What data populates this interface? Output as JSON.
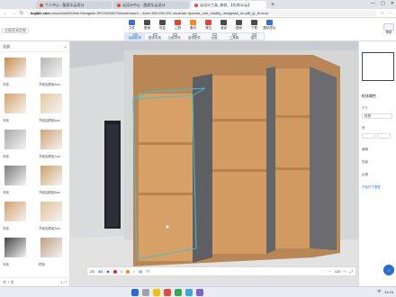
{
  "browser": {
    "tabs": [
      {
        "title": "个人中心 - 酷家乐云设计",
        "active": false
      },
      {
        "title": "云设计中心 - 酷家乐云设计",
        "active": false
      },
      {
        "title": "云设计工具_装修_【在线3D云】",
        "active": true
      }
    ],
    "new_tab": "+",
    "url_host": "kujiale.com",
    "url_path": "/cloud/tool/h5/bim?designid=3FO3U50B70&redirecturl=...&nm=000.000.001.zhuzhan.diploma_cert_modify_designid&_id=y8t_gi_th=true"
  },
  "app": {
    "left_label": "全屋家具定制",
    "top_tools": [
      {
        "label": "文件",
        "color": "#3b6fd1"
      },
      {
        "label": "撤销",
        "color": "#4b4b4b"
      },
      {
        "label": "恢复",
        "color": "#4b4b4b"
      },
      {
        "label": "工具",
        "color": "#e0433a"
      },
      {
        "label": "素材",
        "color": "#f28a1e"
      },
      {
        "label": "清空",
        "color": "#e0433a"
      },
      {
        "label": "渲染",
        "color": "#4b4b4b"
      },
      {
        "label": "图纸",
        "color": "#4b4b4b"
      },
      {
        "label": "下载",
        "color": "#4b4b4b"
      },
      {
        "label": "图纸导出",
        "color": "#3b6fd1"
      }
    ],
    "sub_tools": [
      "绘制柜体",
      "整体布局",
      "功能零件",
      "装饰配件",
      "台面",
      "工具箱",
      "组件"
    ],
    "right_button": "帮助"
  },
  "library": {
    "header": "全部",
    "items": [
      {
        "label": "衣柜",
        "color": "#c98b4b"
      },
      {
        "label": "书柜抽屉组6cm",
        "color": "#b7b7b7"
      },
      {
        "label": "衣柜",
        "color": "#d8a46a"
      },
      {
        "label": "书柜抽屉组6cm",
        "color": "#e5c8a0"
      },
      {
        "label": "衣柜",
        "color": "#a8a8a8"
      },
      {
        "label": "书柜抽屉组7cm",
        "color": "#d2a273"
      },
      {
        "label": "衣柜",
        "color": "#7b7b7b"
      },
      {
        "label": "书柜抽屉组8cm",
        "color": "#cfa06a"
      },
      {
        "label": "衣柜",
        "color": "#d4a06a"
      },
      {
        "label": "书柜抽屉组9cm",
        "color": "#e0c296"
      },
      {
        "label": "衣柜",
        "color": "#444444"
      },
      {
        "label": "镜柜",
        "color": "#bfa083"
      }
    ],
    "footer_left": "共 7 页",
    "footer_right": "1 / 7"
  },
  "props": {
    "section_title": "柜体属性",
    "size_label": "尺寸",
    "material_label": "材质",
    "width_label": "宽",
    "height_label": "高",
    "width_value": "",
    "height_value": "",
    "edit_label": "编辑",
    "scene_label": "场景",
    "texture_label": "纹理",
    "hint": "产品尺寸属性"
  },
  "viewbar": {
    "mode_2d": "2D",
    "mode_3d": "3D",
    "count_red": "4",
    "count_orange": "0",
    "count_grey": "77",
    "zoom": "100",
    "unit": "%"
  },
  "taskbar": {
    "time": "11:24",
    "lang": "中"
  }
}
